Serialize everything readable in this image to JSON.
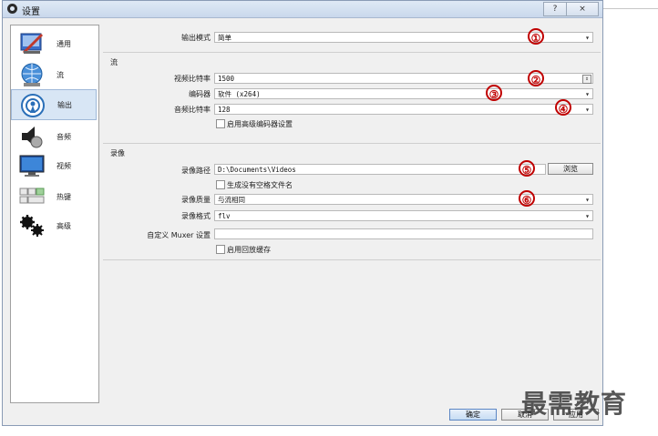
{
  "window": {
    "title": "设置",
    "help_btn": "?",
    "close_btn": "×"
  },
  "sidebar": {
    "items": [
      {
        "label": "通用",
        "icon": "general-icon"
      },
      {
        "label": "流",
        "icon": "stream-icon"
      },
      {
        "label": "输出",
        "icon": "output-icon"
      },
      {
        "label": "音频",
        "icon": "audio-icon"
      },
      {
        "label": "视频",
        "icon": "video-icon"
      },
      {
        "label": "热键",
        "icon": "hotkeys-icon"
      },
      {
        "label": "高级",
        "icon": "advanced-icon"
      }
    ],
    "active_index": 2
  },
  "output": {
    "mode_label": "输出模式",
    "mode_value": "简单"
  },
  "stream": {
    "section_title": "流",
    "video_bitrate_label": "视频比特率",
    "video_bitrate_value": "1500",
    "encoder_label": "编码器",
    "encoder_value": "软件 (x264)",
    "audio_bitrate_label": "音频比特率",
    "audio_bitrate_value": "128",
    "advanced_encoder_label": "启用高级编码器设置"
  },
  "recording": {
    "section_title": "录像",
    "path_label": "录像路径",
    "path_value": "D:\\Documents\\Videos",
    "browse_label": "浏览",
    "no_space_label": "生成没有空格文件名",
    "quality_label": "录像质量",
    "quality_value": "与流相同",
    "format_label": "录像格式",
    "format_value": "flv",
    "muxer_label": "自定义 Muxer 设置",
    "muxer_value": "",
    "replay_buffer_label": "启用回放缓存"
  },
  "buttons": {
    "ok": "确定",
    "cancel": "取消",
    "apply": "应用"
  },
  "markers": [
    "①",
    "②",
    "③",
    "④",
    "⑤",
    "⑥"
  ],
  "watermark": "最需教育",
  "colors": {
    "marker": "#c00000",
    "active_sidebar": "#d8e6f5"
  }
}
